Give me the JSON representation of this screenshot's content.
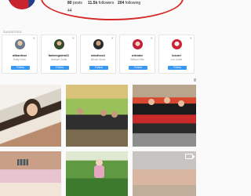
{
  "profile": {
    "posts_count": "80",
    "posts_label": "posts",
    "followers_count": "11.5k",
    "followers_label": "followers",
    "following_count": "204",
    "following_label": "following",
    "partial_line": "44"
  },
  "suggested": {
    "label": "SUGGESTED",
    "follow_label": "Follow",
    "dismiss_icon": "close-icon",
    "items": [
      {
        "username": "alibardeos",
        "fullname": "Emily Rohn"
      },
      {
        "username": "fantemgalera31",
        "fullname": "Hannah Crafts"
      },
      {
        "username": "minolisca1",
        "fullname": "Minnie Stone"
      },
      {
        "username": "wilcrake",
        "fullname": "William Reis"
      },
      {
        "username": "luxcarl",
        "fullname": "Lux Carlie"
      }
    ]
  },
  "posts": {
    "video_icon": "video-camera-icon"
  },
  "colors": {
    "follow_button": "#3897f0",
    "annotation_oval": "#d62a2a"
  }
}
